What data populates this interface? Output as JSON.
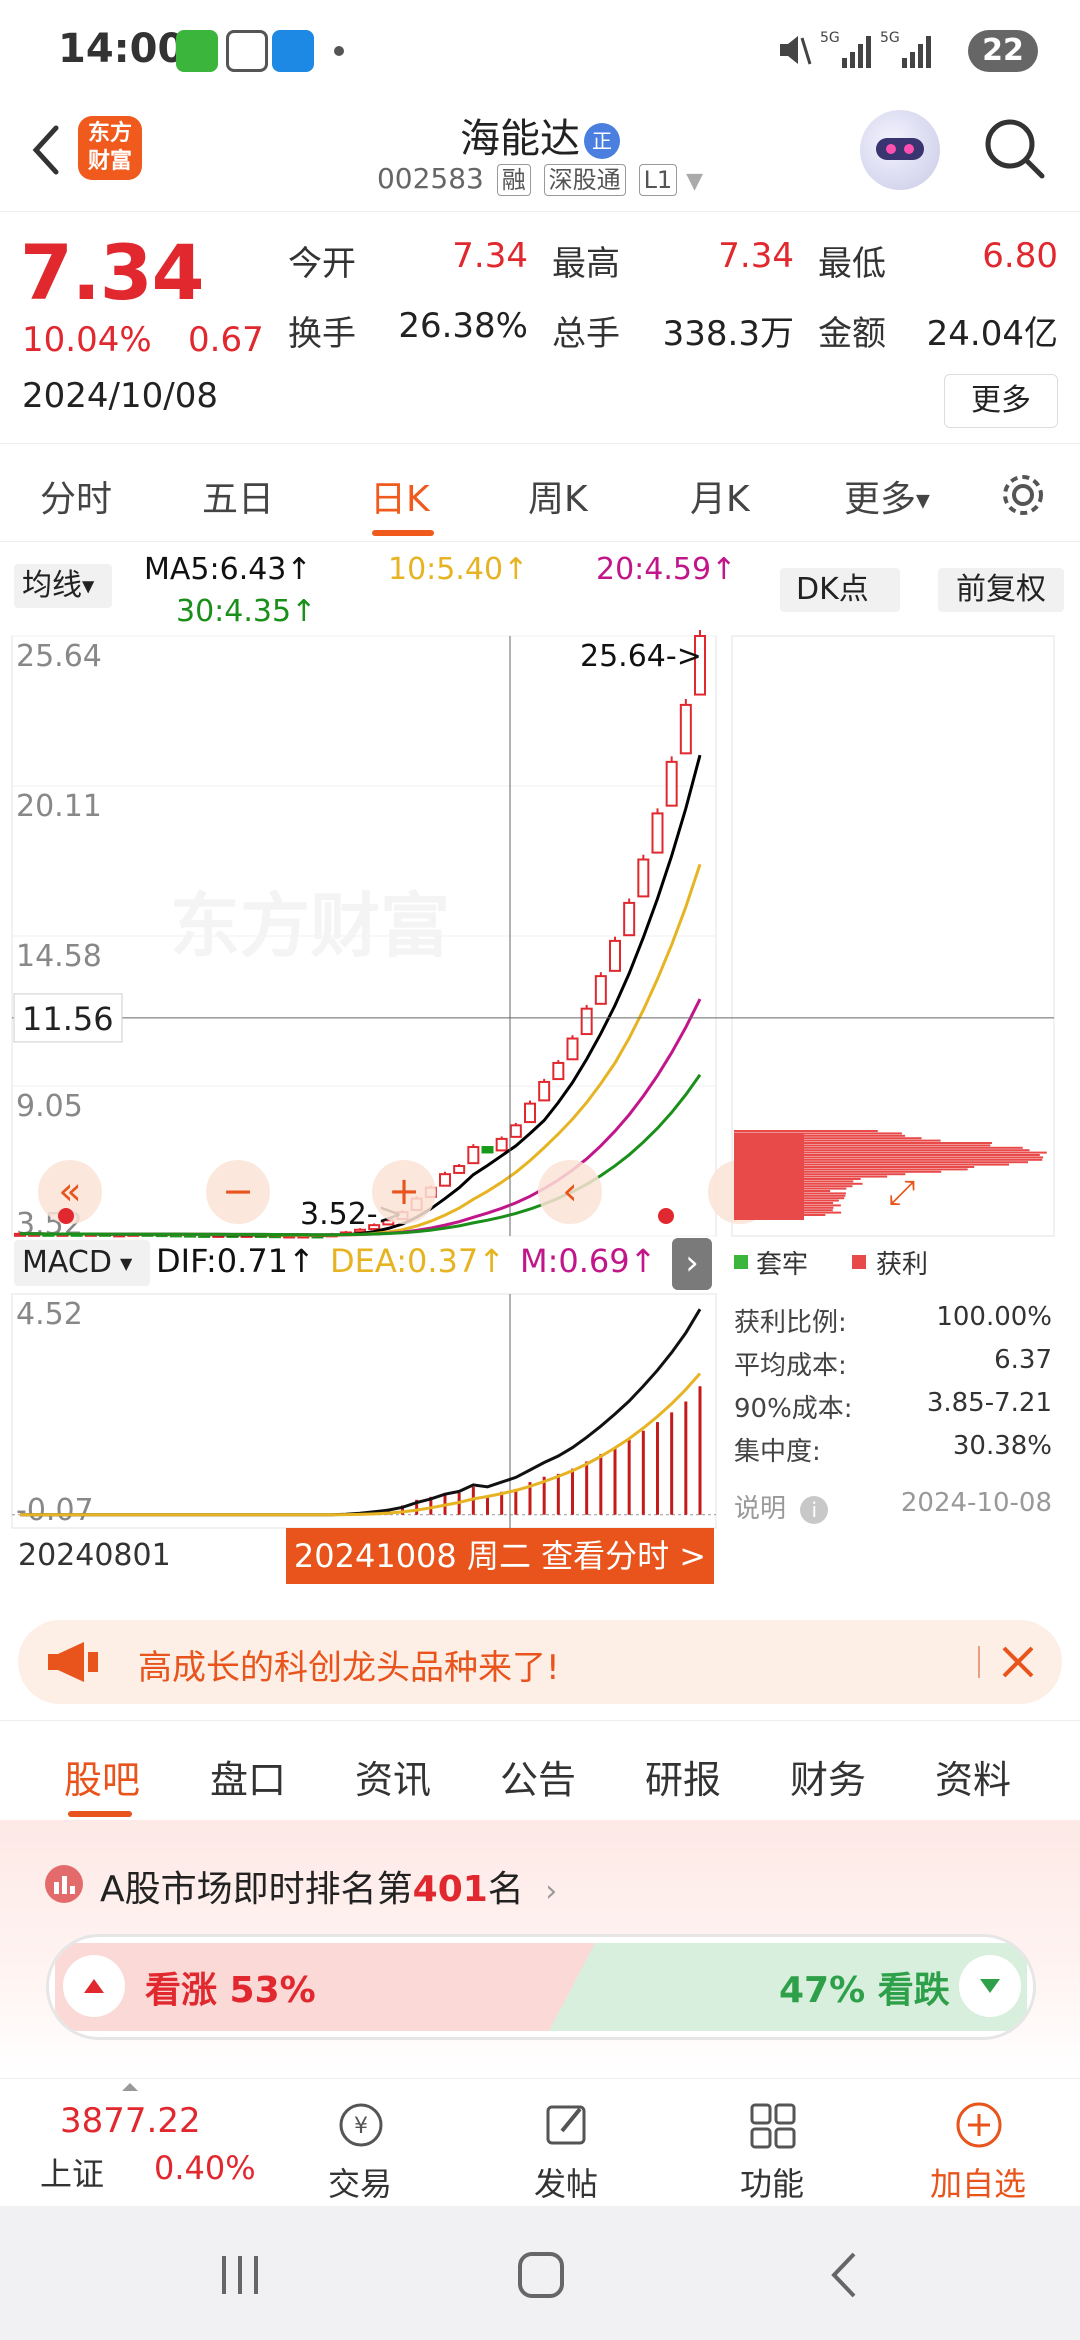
{
  "status_bar": {
    "time": "14:00",
    "battery": "22"
  },
  "header": {
    "logo_text": "东方财富",
    "stock_name": "海能达",
    "name_badge": "正",
    "stock_code": "002583",
    "tags": [
      "融",
      "深股通",
      "L1"
    ]
  },
  "quote": {
    "price": "7.34",
    "change_pct": "10.04%",
    "change": "0.67",
    "date": "2024/10/08",
    "open_label": "今开",
    "open": "7.34",
    "high_label": "最高",
    "high": "7.34",
    "low_label": "最低",
    "low": "6.80",
    "turnover_label": "换手",
    "turnover": "26.38%",
    "volume_label": "总手",
    "volume": "338.3万",
    "amount_label": "金额",
    "amount": "24.04亿",
    "more": "更多"
  },
  "period_tabs": [
    "分时",
    "五日",
    "日K",
    "周K",
    "月K",
    "更多"
  ],
  "indicators": {
    "ma_select": "均线",
    "ma5": "MA5:6.43↑",
    "ma10": "10:5.40↑",
    "ma20": "20:4.59↑",
    "ma30": "30:4.35↑",
    "dk": "DK点",
    "adjust": "前复权"
  },
  "chart_data": [
    {
      "type": "candlestick",
      "title": "",
      "y_ticks": [
        "25.64",
        "20.11",
        "14.58",
        "9.05",
        "3.52"
      ],
      "ylim": [
        3.52,
        25.64
      ],
      "crosshair_value": "11.56",
      "max_label": "25.64->",
      "min_label": "3.52->",
      "watermark": "东方财富",
      "x_start": "20240801",
      "x_cursor": "20241008 周二 查看分时 >",
      "candles_close": [
        3.6,
        3.6,
        3.58,
        3.6,
        3.59,
        3.6,
        3.57,
        3.58,
        3.6,
        3.59,
        3.58,
        3.57,
        3.56,
        3.55,
        3.56,
        3.55,
        3.56,
        3.55,
        3.53,
        3.54,
        3.54,
        3.52,
        3.58,
        3.65,
        3.75,
        3.92,
        4.1,
        4.4,
        4.9,
        5.3,
        5.8,
        6.1,
        6.8,
        6.6,
        7.1,
        7.6,
        8.4,
        9.2,
        9.9,
        10.8,
        11.9,
        13.1,
        14.4,
        15.8,
        17.4,
        19.1,
        21.0,
        23.1,
        25.64
      ],
      "series": [
        {
          "name": "MA5",
          "color": "#000000"
        },
        {
          "name": "MA10",
          "color": "#e6b422"
        },
        {
          "name": "MA20",
          "color": "#c0168a"
        },
        {
          "name": "MA30",
          "color": "#1a8f1a"
        }
      ]
    },
    {
      "type": "bar",
      "title": "MACD",
      "y_ticks": [
        "4.52",
        "-0.07"
      ],
      "ylim": [
        -0.07,
        4.52
      ],
      "dif": "DIF:0.71↑",
      "dea": "DEA:0.37↑",
      "m": "M:0.69↑"
    }
  ],
  "chips": {
    "legend_trapped": "套牢",
    "legend_profit": "获利",
    "rows": [
      {
        "label": "获利比例:",
        "value": "100.00%"
      },
      {
        "label": "平均成本:",
        "value": "6.37"
      },
      {
        "label": "90%成本:",
        "value": "3.85-7.21"
      },
      {
        "label": "集中度:",
        "value": "30.38%"
      }
    ],
    "note_label": "说明",
    "note_date": "2024-10-08"
  },
  "banner": {
    "text": "高成长的科创龙头品种来了!"
  },
  "info_tabs": [
    "股吧",
    "盘口",
    "资讯",
    "公告",
    "研报",
    "财务",
    "资料"
  ],
  "rank": {
    "prefix": "A股市场即时排名第",
    "number": "401",
    "suffix": "名",
    "up_label": "看涨 53%",
    "down_label": "47% 看跌"
  },
  "bottom_nav": {
    "index_value": "3877.22",
    "index_name": "上证",
    "index_pct": "0.40%",
    "items": [
      "交易",
      "发帖",
      "功能",
      "加自选"
    ]
  },
  "colors": {
    "up": "#e0282e",
    "down": "#2ea04a",
    "accent": "#e8541b"
  }
}
